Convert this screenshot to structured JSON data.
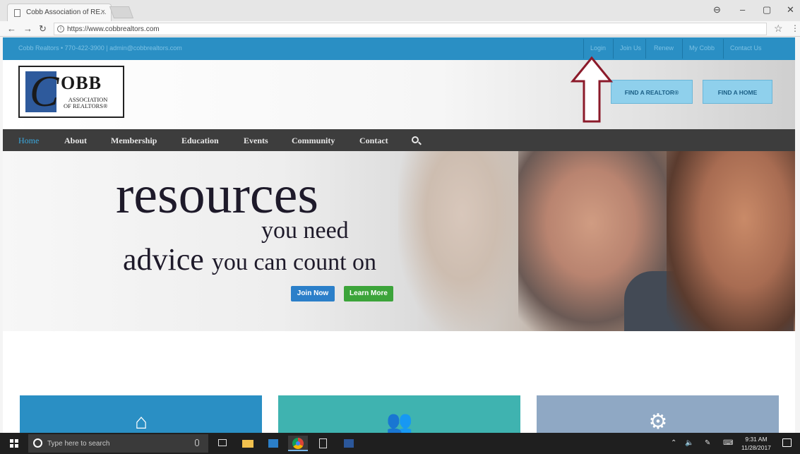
{
  "browser": {
    "tab_title": "Cobb Association of RE...",
    "tab_close": "×",
    "url": "https://www.cobbrealtors.com",
    "window_controls": [
      "⊖",
      "–",
      "▢",
      "✕"
    ]
  },
  "topbar": {
    "contact": "Cobb Realtors  •  770-422-3900  |  admin@cobbrealtors.com",
    "links": [
      "Login",
      "Join Us",
      "Renew",
      "My Cobb",
      "Contact Us"
    ]
  },
  "logo": {
    "letter": "C",
    "main": "OBB",
    "sub_line1": "ASSOCIATION",
    "sub_line2": "OF REALTORS®"
  },
  "cta": {
    "find_realtor": "FIND A REALTOR®",
    "find_home": "FIND A HOME"
  },
  "nav": {
    "items": [
      "Home",
      "About",
      "Membership",
      "Education",
      "Events",
      "Community",
      "Contact"
    ]
  },
  "hero": {
    "line1": "resources",
    "line2": "you need",
    "line3_big": "advice",
    "line3_small": "you can count on",
    "join_label": "Join Now",
    "learn_label": "Learn More"
  },
  "cards": [
    {
      "icon": "home-icon",
      "color": "#2a8fc4"
    },
    {
      "icon": "people-icon",
      "color": "#3fb3b0"
    },
    {
      "icon": "gears-icon",
      "color": "#8fa8c4"
    }
  ],
  "taskbar": {
    "search_placeholder": "Type here to search",
    "time": "9:31 AM",
    "date": "11/28/2017"
  },
  "colors": {
    "topbar": "#2a8fc4",
    "navbar": "#3d3d3d",
    "cta": "#8fd0ec",
    "join": "#2b7fc9",
    "learn": "#3ca43a",
    "arrow": "#8b1a2a"
  }
}
